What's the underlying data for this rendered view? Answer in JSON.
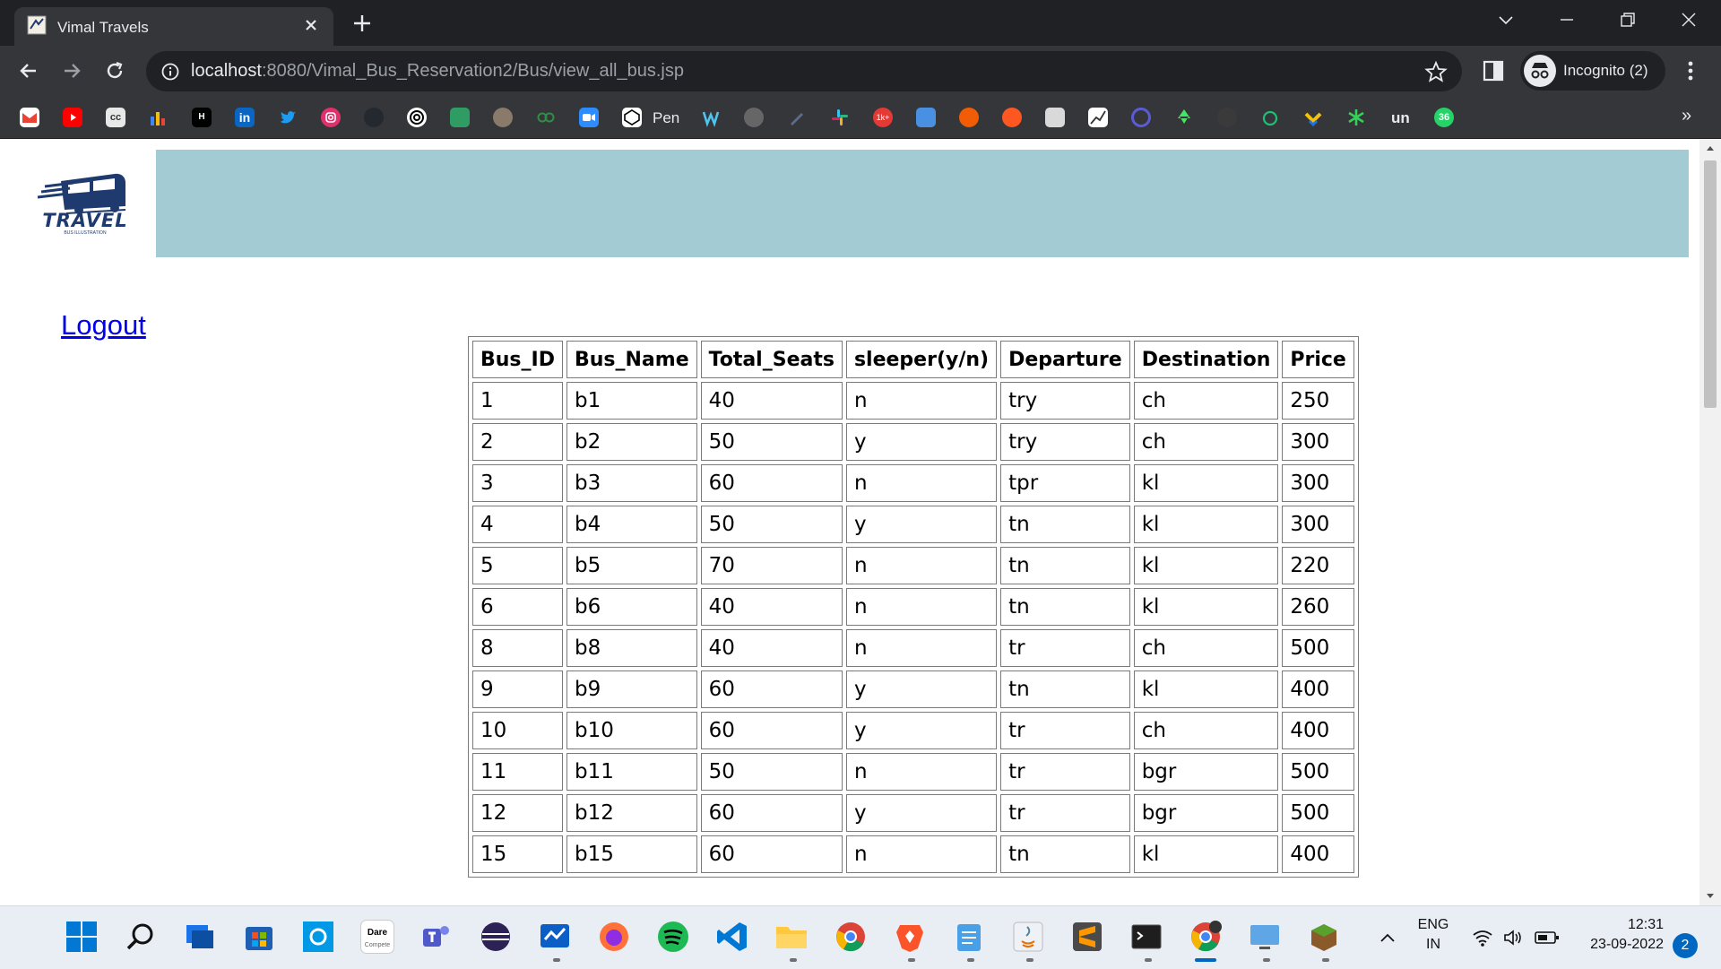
{
  "browser": {
    "tab_title": "Vimal Travels",
    "url_host": "localhost",
    "url_path": ":8080/Vimal_Bus_Reservation2/Bus/view_all_bus.jsp",
    "profile_label": "Incognito (2)",
    "bookmark_pen_label": "Pen",
    "bookmark_un_label": "un",
    "bookmark_badge": "36"
  },
  "page": {
    "logo_text": "TRAVEL",
    "logo_subtext": "BUS ILLUSTRATION",
    "logout_label": "Logout",
    "banner_color": "#a3cbd3"
  },
  "table": {
    "headers": [
      "Bus_ID",
      "Bus_Name",
      "Total_Seats",
      "sleeper(y/n)",
      "Departure",
      "Destination",
      "Price"
    ],
    "rows": [
      [
        "1",
        "b1",
        "40",
        "n",
        "try",
        "ch",
        "250"
      ],
      [
        "2",
        "b2",
        "50",
        "y",
        "try",
        "ch",
        "300"
      ],
      [
        "3",
        "b3",
        "60",
        "n",
        "tpr",
        "kl",
        "300"
      ],
      [
        "4",
        "b4",
        "50",
        "y",
        "tn",
        "kl",
        "300"
      ],
      [
        "5",
        "b5",
        "70",
        "n",
        "tn",
        "kl",
        "220"
      ],
      [
        "6",
        "b6",
        "40",
        "n",
        "tn",
        "kl",
        "260"
      ],
      [
        "8",
        "b8",
        "40",
        "n",
        "tr",
        "ch",
        "500"
      ],
      [
        "9",
        "b9",
        "60",
        "y",
        "tn",
        "kl",
        "400"
      ],
      [
        "10",
        "b10",
        "60",
        "y",
        "tr",
        "ch",
        "400"
      ],
      [
        "11",
        "b11",
        "50",
        "n",
        "tr",
        "bgr",
        "500"
      ],
      [
        "12",
        "b12",
        "60",
        "y",
        "tr",
        "bgr",
        "500"
      ],
      [
        "15",
        "b15",
        "60",
        "n",
        "tn",
        "kl",
        "400"
      ]
    ]
  },
  "taskbar": {
    "dare_label": "Dare",
    "dare_sub": "Compete",
    "lang_top": "ENG",
    "lang_bottom": "IN",
    "time": "12:31",
    "date": "23-09-2022",
    "notification_count": "2"
  }
}
